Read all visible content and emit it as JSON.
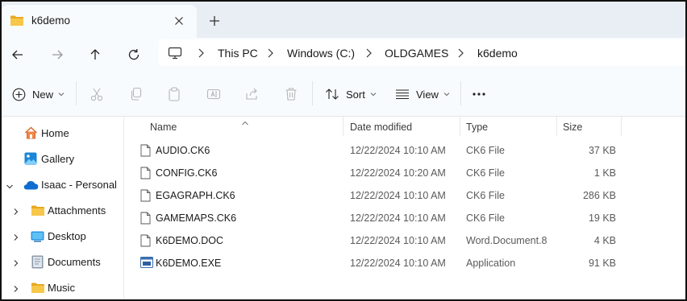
{
  "window": {
    "tab_title": "k6demo",
    "close_glyph": "✕",
    "newtab_glyph": "+"
  },
  "nav": {
    "back_icon": "back-arrow-icon",
    "forward_icon": "forward-arrow-icon",
    "up_icon": "up-arrow-icon",
    "refresh_icon": "refresh-icon"
  },
  "breadcrumb": {
    "items": [
      "This PC",
      "Windows (C:)",
      "OLDGAMES",
      "k6demo"
    ],
    "separator": ">"
  },
  "toolbar": {
    "new_label": "New",
    "sort_label": "Sort",
    "view_label": "View",
    "more_label": "···"
  },
  "sidebar": {
    "items": [
      {
        "label": "Home",
        "icon": "home-icon"
      },
      {
        "label": "Gallery",
        "icon": "gallery-icon"
      },
      {
        "label": "Isaac - Personal",
        "icon": "onedrive-cloud-icon",
        "expanded": true
      },
      {
        "label": "Attachments",
        "icon": "folder-icon"
      },
      {
        "label": "Desktop",
        "icon": "desktop-icon"
      },
      {
        "label": "Documents",
        "icon": "documents-icon"
      },
      {
        "label": "Music",
        "icon": "folder-icon"
      }
    ]
  },
  "columns": {
    "name": "Name",
    "date": "Date modified",
    "type": "Type",
    "size": "Size"
  },
  "files": [
    {
      "name": "AUDIO.CK6",
      "date": "12/22/2024 10:10 AM",
      "type": "CK6 File",
      "size": "37 KB",
      "icon": "file-icon"
    },
    {
      "name": "CONFIG.CK6",
      "date": "12/22/2024 10:20 AM",
      "type": "CK6 File",
      "size": "1 KB",
      "icon": "file-icon"
    },
    {
      "name": "EGAGRAPH.CK6",
      "date": "12/22/2024 10:10 AM",
      "type": "CK6 File",
      "size": "286 KB",
      "icon": "file-icon"
    },
    {
      "name": "GAMEMAPS.CK6",
      "date": "12/22/2024 10:10 AM",
      "type": "CK6 File",
      "size": "19 KB",
      "icon": "file-icon"
    },
    {
      "name": "K6DEMO.DOC",
      "date": "12/22/2024 10:10 AM",
      "type": "Word.Document.8",
      "size": "4 KB",
      "icon": "file-icon"
    },
    {
      "name": "K6DEMO.EXE",
      "date": "12/22/2024 10:10 AM",
      "type": "Application",
      "size": "91 KB",
      "icon": "application-icon"
    }
  ],
  "colors": {
    "accent": "#005fb8",
    "folder": "#f5c242",
    "titlebar": "#e9eef4",
    "toolbar": "#f8fbfd"
  }
}
